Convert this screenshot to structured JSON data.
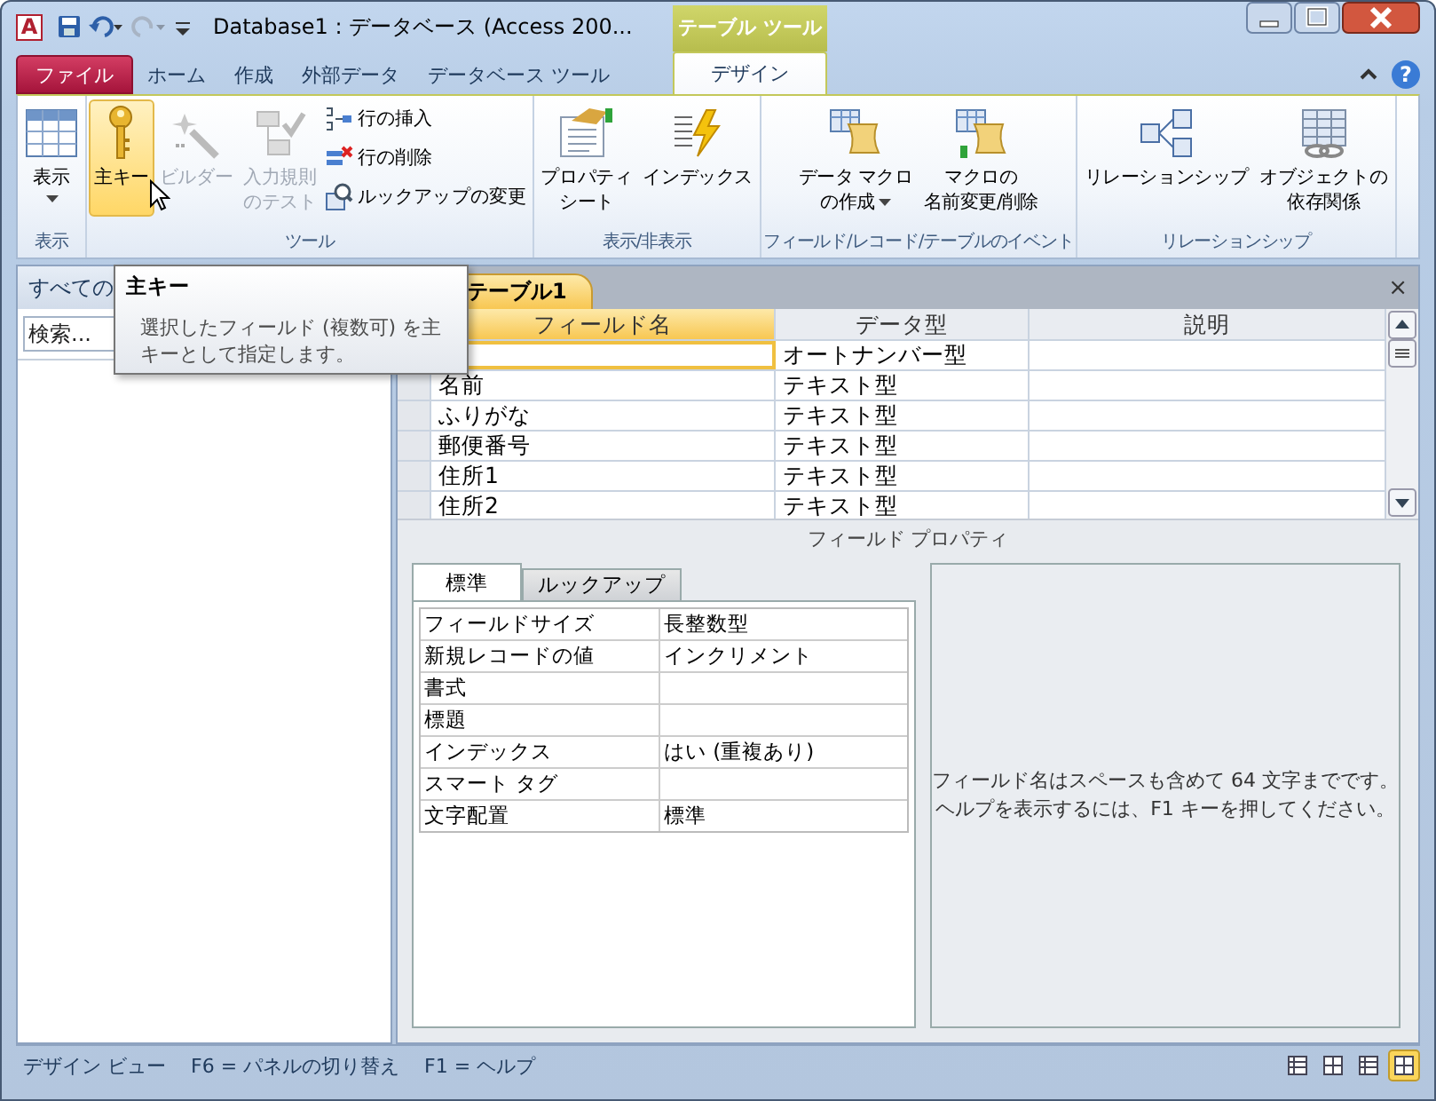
{
  "window": {
    "app_icon_letter": "A",
    "title": "Database1 : データベース (Access 200...",
    "context_header": "テーブル ツール"
  },
  "ribbon_tabs": [
    {
      "label": "ファイル",
      "kind": "file",
      "selected": false
    },
    {
      "label": "ホーム",
      "kind": "plain",
      "selected": false
    },
    {
      "label": "作成",
      "kind": "plain",
      "selected": false
    },
    {
      "label": "外部データ",
      "kind": "plain",
      "selected": false
    },
    {
      "label": "データベース ツール",
      "kind": "plain",
      "selected": false
    },
    {
      "label": "デザイン",
      "kind": "context",
      "selected": true
    }
  ],
  "help_glyph": "?",
  "ribbon_groups": [
    {
      "label": "表示",
      "buttons": [
        {
          "kind": "large",
          "lines": [
            "表示"
          ],
          "dropdown": true,
          "disabled": false,
          "selected": false
        }
      ]
    },
    {
      "label": "ツール",
      "buttons": [
        {
          "kind": "large",
          "lines": [
            "主キー"
          ],
          "dropdown": false,
          "disabled": false,
          "selected": true
        },
        {
          "kind": "large",
          "lines": [
            "ビルダー"
          ],
          "dropdown": false,
          "disabled": true,
          "selected": false
        },
        {
          "kind": "large",
          "lines": [
            "入力規則",
            "のテスト"
          ],
          "dropdown": false,
          "disabled": true,
          "selected": false
        },
        {
          "kind": "small",
          "lines": [
            "行の挿入"
          ],
          "dropdown": false,
          "disabled": false,
          "selected": false
        },
        {
          "kind": "small",
          "lines": [
            "行の削除"
          ],
          "dropdown": false,
          "disabled": false,
          "selected": false
        },
        {
          "kind": "small",
          "lines": [
            "ルックアップの変更"
          ],
          "dropdown": false,
          "disabled": false,
          "selected": false
        }
      ]
    },
    {
      "label": "表示/非表示",
      "buttons": [
        {
          "kind": "large",
          "lines": [
            "プロパティ",
            "シート"
          ],
          "dropdown": false,
          "disabled": false,
          "selected": false
        },
        {
          "kind": "large",
          "lines": [
            "インデックス"
          ],
          "dropdown": false,
          "disabled": false,
          "selected": false
        }
      ]
    },
    {
      "label": "フィールド/レコード/テーブルのイベント",
      "buttons": [
        {
          "kind": "large",
          "lines": [
            "データ マクロ",
            "の作成"
          ],
          "dropdown": true,
          "disabled": false,
          "selected": false
        },
        {
          "kind": "large",
          "lines": [
            "マクロの",
            "名前変更/削除"
          ],
          "dropdown": false,
          "disabled": false,
          "selected": false
        }
      ]
    },
    {
      "label": "リレーションシップ",
      "buttons": [
        {
          "kind": "large",
          "lines": [
            "リレーションシップ"
          ],
          "dropdown": false,
          "disabled": false,
          "selected": false
        },
        {
          "kind": "large",
          "lines": [
            "オブジェクトの",
            "依存関係"
          ],
          "dropdown": false,
          "disabled": false,
          "selected": false
        }
      ]
    }
  ],
  "tooltip": {
    "title": "主キー",
    "lines": [
      "選択したフィールド (複数可) を主",
      "キーとして指定します。"
    ]
  },
  "nav_pane": {
    "header": "すべての",
    "search_placeholder": "検索..."
  },
  "document": {
    "tab": "テーブル1",
    "close_glyph": "×",
    "columns": [
      {
        "label": "フィールド名",
        "selected": true
      },
      {
        "label": "データ型",
        "selected": false
      },
      {
        "label": "説明",
        "selected": false
      }
    ],
    "rows": [
      {
        "data_type": "オートナンバー型",
        "selected": true
      },
      {
        "field_name": "名前",
        "data_type": "テキスト型",
        "selected": false
      },
      {
        "field_name": "ふりがな",
        "data_type": "テキスト型",
        "selected": false
      },
      {
        "field_name": "郵便番号",
        "data_type": "テキスト型",
        "selected": false
      },
      {
        "field_name": "住所1",
        "data_type": "テキスト型",
        "selected": false
      },
      {
        "field_name": "住所2",
        "data_type": "テキスト型",
        "selected": false
      }
    ],
    "field_properties_label": "フィールド プロパティ",
    "property_tabs": [
      {
        "label": "標準",
        "selected": true
      },
      {
        "label": "ルックアップ",
        "selected": false
      }
    ],
    "properties": [
      {
        "label": "フィールドサイズ",
        "value": "長整数型"
      },
      {
        "label": "新規レコードの値",
        "value": "インクリメント"
      },
      {
        "label": "書式"
      },
      {
        "label": "標題"
      },
      {
        "label": "インデックス",
        "value": "はい (重複あり)"
      },
      {
        "label": "スマート タグ"
      },
      {
        "label": "文字配置",
        "value": "標準"
      }
    ],
    "help_lines": [
      "フィールド名はスペースも含めて 64 文字までです。",
      "ヘルプを表示するには、F1 キーを押してください。"
    ]
  },
  "status_bar": {
    "texts": [
      "デザイン ビュー",
      "F6 = パネルの切り替え",
      "F1 = ヘルプ"
    ],
    "view_buttons": [
      {
        "selected": false
      },
      {
        "selected": false
      },
      {
        "selected": false
      },
      {
        "selected": true
      }
    ]
  }
}
